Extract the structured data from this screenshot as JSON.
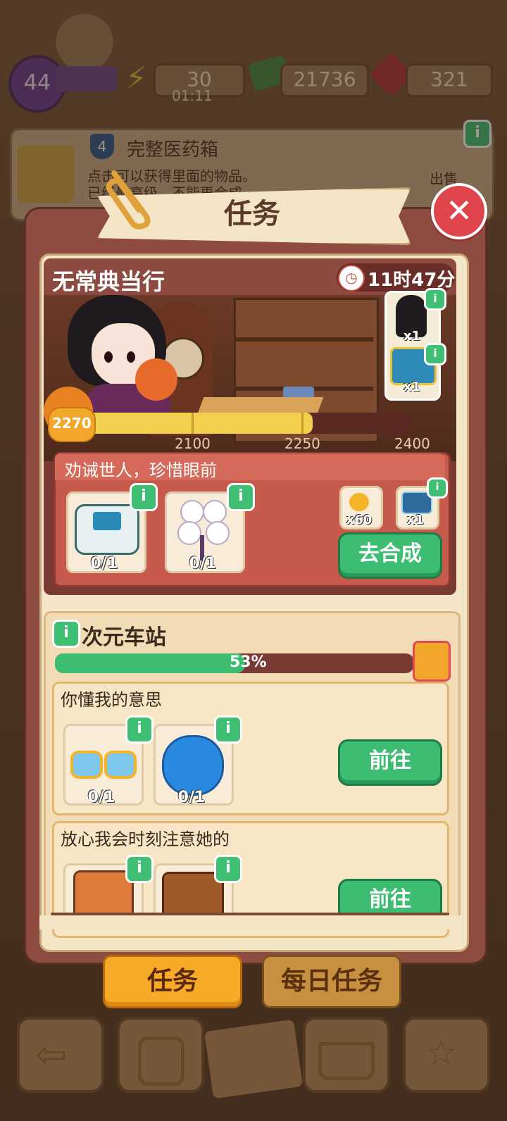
{
  "hud": {
    "level": "44",
    "energy": "30",
    "energy_timer": "01:11",
    "cash": "21736",
    "gems": "321"
  },
  "bg_item": {
    "level": "4",
    "name": "完整医药箱",
    "desc1": "点击可以获得里面的物品。",
    "desc2": "已经最高级，不能再合成",
    "sell": "出售"
  },
  "dialog": {
    "title": "任务",
    "close_icon": "close-icon"
  },
  "main_quest": {
    "shop_name": "无常典当行",
    "timer": "11时47分",
    "rewards_side": [
      {
        "icon": "character-reward",
        "count": "x1"
      },
      {
        "icon": "treasure-chest",
        "count": "x1"
      }
    ],
    "progress": {
      "current": "2270",
      "ticks": [
        "2100",
        "2250",
        "2400"
      ],
      "value": 2270,
      "min": 1950,
      "max": 2400
    },
    "subtask": {
      "title": "劝诫世人，珍惜眼前",
      "items": [
        {
          "icon": "blood-pressure-monitor",
          "progress": "0/1"
        },
        {
          "icon": "white-flower-bouquet",
          "progress": "0/1"
        }
      ],
      "rewards": [
        {
          "icon": "coin-bag",
          "count": "x60"
        },
        {
          "icon": "blue-chest",
          "count": "x1"
        }
      ],
      "button": "去合成"
    }
  },
  "station": {
    "name": "次元车站",
    "percent": "53%",
    "percent_value": 0.53,
    "tasks": [
      {
        "title": "你懂我的意思",
        "items": [
          {
            "icon": "sunglasses",
            "progress": "0/1"
          },
          {
            "icon": "face-mask",
            "progress": "0/1"
          }
        ],
        "button": "前往"
      },
      {
        "title": "放心我会时刻注意她的",
        "items": [
          {
            "icon": "camera",
            "progress": ""
          },
          {
            "icon": "leather-bag",
            "progress": ""
          }
        ],
        "button": "前往"
      }
    ]
  },
  "tabs": {
    "tasks": "任务",
    "daily": "每日任务"
  },
  "colors": {
    "accent_green": "#3cbd72",
    "tab_active": "#f7a928",
    "panel": "#8e4b3f",
    "progress_yellow": "#f3d04d"
  }
}
